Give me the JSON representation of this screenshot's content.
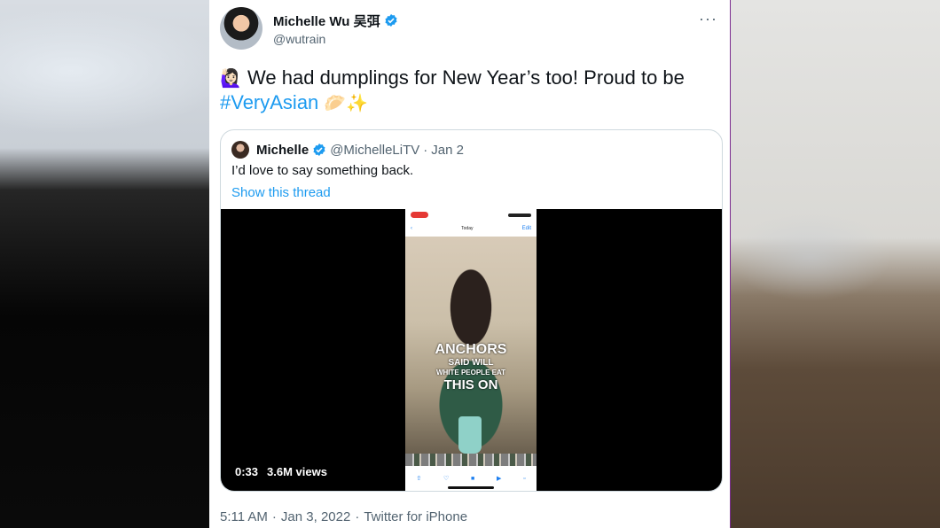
{
  "author": {
    "display_name": "Michelle Wu 吴弭",
    "handle": "@wutrain",
    "verified_icon": "verified-badge-icon",
    "avatar_icon": "profile-avatar"
  },
  "more_menu": "···",
  "tweet": {
    "emoji_lead": "🙋🏻‍♀️",
    "text": "We had dumplings for New Year’s too! Proud to be",
    "hashtag": "#VeryAsian",
    "emoji_trail": "🥟✨"
  },
  "quote": {
    "display_name": "Michelle",
    "handle": "@MichelleLiTV",
    "separator": "·",
    "date": "Jan 2",
    "text": "I’d love to say something back.",
    "thread_link": "Show this thread",
    "video": {
      "duration": "0:33",
      "views": "3.6M views",
      "phone_nav_center": "Today",
      "phone_nav_right": "Edit",
      "overlay": [
        "ANCHORS",
        "SAID WILL",
        "WHITE PEOPLE EAT",
        "THIS ON"
      ]
    }
  },
  "footer": {
    "time": "5:11 AM",
    "sep1": "·",
    "date": "Jan 3, 2022",
    "sep2": "·",
    "client": "Twitter for iPhone"
  },
  "colors": {
    "link": "#1d9bf0",
    "text": "#0f1419",
    "muted": "#536471"
  }
}
